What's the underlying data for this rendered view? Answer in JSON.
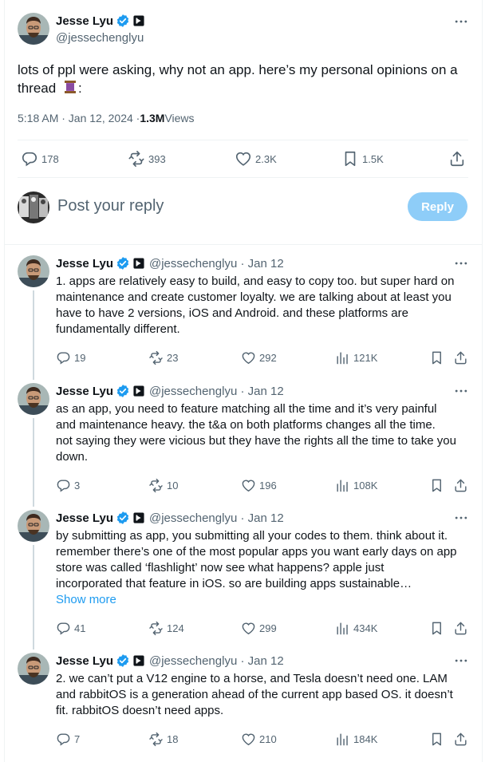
{
  "main_tweet": {
    "author_name": "Jesse Lyu",
    "handle": "@jessechenglyu",
    "text": "lots of ppl were asking, why not an app. here’s my personal opinions on a thread",
    "text_suffix": ":",
    "time": "5:18 AM · Jan 12, 2024 · ",
    "views_count": "1.3M",
    "views_label": " Views",
    "replies": "178",
    "reposts": "393",
    "likes": "2.3K",
    "bookmarks": "1.5K"
  },
  "reply_box": {
    "placeholder": "Post your reply",
    "button": "Reply"
  },
  "replies": [
    {
      "author_name": "Jesse Lyu",
      "handle_date": "@jessechenglyu · Jan 12",
      "lines": [
        "1. apps are relatively easy to build, and easy to copy too. but super hard on",
        "maintenance and create customer loyalty. we are talking about at least you",
        "have to have 2 versions, iOS and Android. and these platforms are",
        "fundamentally different."
      ],
      "replies": "19",
      "reposts": "23",
      "likes": "292",
      "views": "121K"
    },
    {
      "author_name": "Jesse Lyu",
      "handle_date": "@jessechenglyu · Jan 12",
      "lines": [
        "as an app, you need to feature matching all the time and it’s very painful",
        "and maintenance heavy. the t&a on both platforms changes all the time.",
        "not saying they were vicious but they have the rights all the time to take you",
        "down."
      ],
      "replies": "3",
      "reposts": "10",
      "likes": "196",
      "views": "108K"
    },
    {
      "author_name": "Jesse Lyu",
      "handle_date": "@jessechenglyu · Jan 12",
      "lines": [
        "by submitting as app, you submitting all your codes to them. think about it.",
        "remember there’s one of the most popular apps you want early days on app",
        "store was called ‘flashlight’ now see what happens? apple just",
        "incorporated that feature in iOS. so are building apps sustainable…"
      ],
      "show_more": "Show more",
      "replies": "41",
      "reposts": "124",
      "likes": "299",
      "views": "434K"
    },
    {
      "author_name": "Jesse Lyu",
      "handle_date": "@jessechenglyu · Jan 12",
      "lines": [
        "2. we can’t put a V12 engine to a horse, and Tesla doesn’t need one. LAM",
        "and rabbitOS is a generation ahead of the current app based OS. it doesn’t",
        "fit. rabbitOS doesn’t need apps."
      ],
      "replies": "7",
      "reposts": "18",
      "likes": "210",
      "views": "184K"
    }
  ],
  "colors": {
    "accent": "#1d9bf0",
    "reply_button_disabled": "#8ecdf8",
    "verified": "#1d9bf0",
    "muted": "#536471"
  }
}
